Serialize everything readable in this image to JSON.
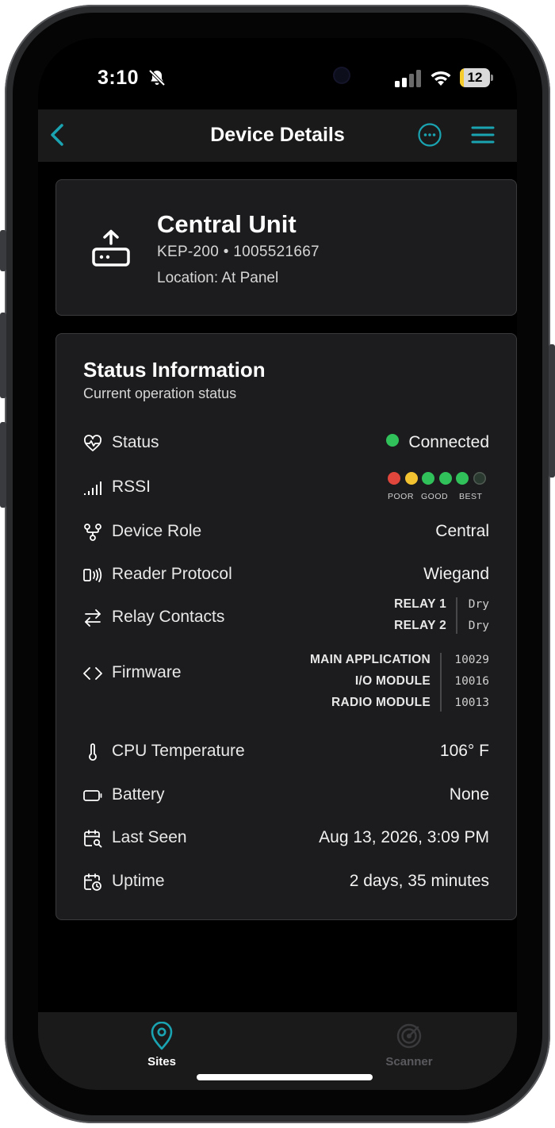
{
  "status_bar": {
    "time": "3:10",
    "battery_level": "12",
    "battery_fraction": 0.12
  },
  "header": {
    "title": "Device Details"
  },
  "device": {
    "name": "Central Unit",
    "model_line": "KEP-200 • 1005521667",
    "location": "Location: At Panel"
  },
  "status": {
    "title": "Status Information",
    "subtitle": "Current operation status",
    "rows": {
      "status": {
        "label": "Status",
        "value": "Connected"
      },
      "rssi": {
        "label": "RSSI",
        "levels": [
          "POOR",
          "GOOD",
          "BEST"
        ],
        "dot_colors": [
          "#e0463c",
          "#f2c230",
          "#30c15a",
          "#30c15a",
          "#30c15a",
          "#2b3a30"
        ],
        "filled_dots": 5,
        "total_dots": 6
      },
      "device_role": {
        "label": "Device Role",
        "value": "Central"
      },
      "reader_protocol": {
        "label": "Reader Protocol",
        "value": "Wiegand"
      },
      "relay_contacts": {
        "label": "Relay Contacts",
        "items": [
          {
            "name": "RELAY 1",
            "value": "Dry"
          },
          {
            "name": "RELAY 2",
            "value": "Dry"
          }
        ]
      },
      "firmware": {
        "label": "Firmware",
        "items": [
          {
            "name": "MAIN APPLICATION",
            "value": "10029"
          },
          {
            "name": "I/O MODULE",
            "value": "10016"
          },
          {
            "name": "RADIO MODULE",
            "value": "10013"
          }
        ]
      },
      "cpu_temperature": {
        "label": "CPU Temperature",
        "value": "106° F"
      },
      "battery": {
        "label": "Battery",
        "value": "None"
      },
      "last_seen": {
        "label": "Last Seen",
        "value": "Aug 13, 2026, 3:09 PM"
      },
      "uptime": {
        "label": "Uptime",
        "value": "2 days, 35 minutes"
      }
    }
  },
  "tabs": [
    {
      "label": "Sites",
      "active": true
    },
    {
      "label": "Scanner",
      "active": false
    }
  ],
  "colors": {
    "accent": "#1aa3b0",
    "card_bg": "#1c1c1e",
    "inactive_tab": "#5a5a5e"
  }
}
